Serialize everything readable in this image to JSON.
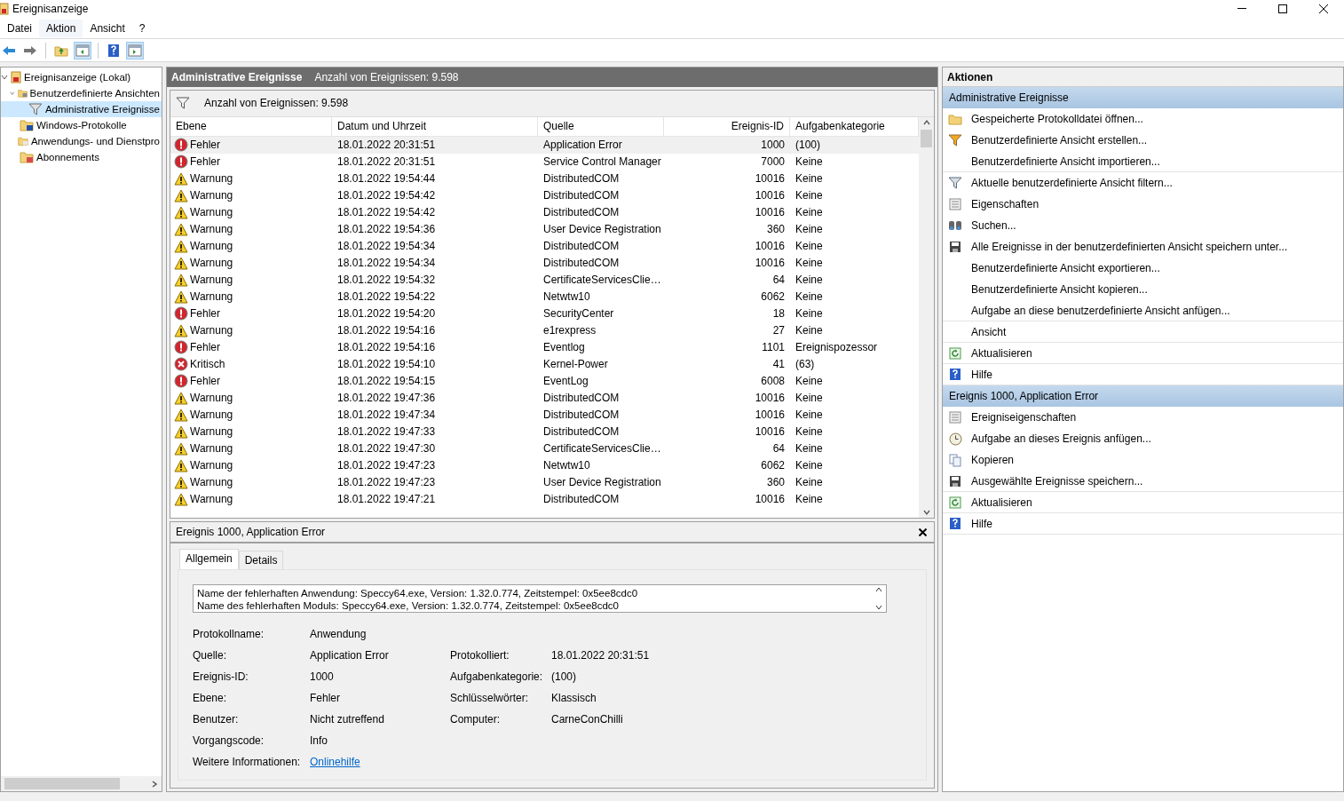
{
  "window": {
    "title": "Ereignisanzeige"
  },
  "menu": [
    {
      "label": "Datei",
      "selected": false
    },
    {
      "label": "Aktion",
      "selected": true
    },
    {
      "label": "Ansicht",
      "selected": false
    },
    {
      "label": "?",
      "selected": false
    }
  ],
  "tree": [
    {
      "label": "Ereignisanzeige (Lokal)",
      "kind": "viewer",
      "expanded": true,
      "selected": false,
      "children": [
        {
          "label": "Benutzerdefinierte Ansichten",
          "kind": "filterfolder",
          "expanded": true,
          "selected": false,
          "children": [
            {
              "label": "Administrative Ereignisse",
              "kind": "filter",
              "expanded": false,
              "selected": true
            }
          ]
        },
        {
          "label": "Windows-Protokolle",
          "kind": "logfolder",
          "expanded": false,
          "selected": false
        },
        {
          "label": "Anwendungs- und Dienstpro",
          "kind": "appfolder",
          "expanded": false,
          "selected": false
        },
        {
          "label": "Abonnements",
          "kind": "subfolder",
          "expanded": false,
          "selected": false
        }
      ]
    }
  ],
  "center": {
    "title": "Administrative Ereignisse",
    "count": "Anzahl von Ereignissen: 9.598",
    "filter_text": "Anzahl von Ereignissen: 9.598"
  },
  "table": {
    "columns": [
      "Ebene",
      "Datum und Uhrzeit",
      "Quelle",
      "Ereignis-ID",
      "Aufgabenkategorie"
    ],
    "rows": [
      {
        "kind": "error",
        "level": "Fehler",
        "date": "18.01.2022 20:31:51",
        "source": "Application Error",
        "id": "1000",
        "category": "(100)",
        "selected": true
      },
      {
        "kind": "error",
        "level": "Fehler",
        "date": "18.01.2022 20:31:51",
        "source": "Service Control Manager",
        "id": "7000",
        "category": "Keine",
        "selected": false
      },
      {
        "kind": "warning",
        "level": "Warnung",
        "date": "18.01.2022 19:54:44",
        "source": "DistributedCOM",
        "id": "10016",
        "category": "Keine",
        "selected": false
      },
      {
        "kind": "warning",
        "level": "Warnung",
        "date": "18.01.2022 19:54:42",
        "source": "DistributedCOM",
        "id": "10016",
        "category": "Keine",
        "selected": false
      },
      {
        "kind": "warning",
        "level": "Warnung",
        "date": "18.01.2022 19:54:42",
        "source": "DistributedCOM",
        "id": "10016",
        "category": "Keine",
        "selected": false
      },
      {
        "kind": "warning",
        "level": "Warnung",
        "date": "18.01.2022 19:54:36",
        "source": "User Device Registration",
        "id": "360",
        "category": "Keine",
        "selected": false
      },
      {
        "kind": "warning",
        "level": "Warnung",
        "date": "18.01.2022 19:54:34",
        "source": "DistributedCOM",
        "id": "10016",
        "category": "Keine",
        "selected": false
      },
      {
        "kind": "warning",
        "level": "Warnung",
        "date": "18.01.2022 19:54:34",
        "source": "DistributedCOM",
        "id": "10016",
        "category": "Keine",
        "selected": false
      },
      {
        "kind": "warning",
        "level": "Warnung",
        "date": "18.01.2022 19:54:32",
        "source": "CertificateServicesClie…",
        "id": "64",
        "category": "Keine",
        "selected": false
      },
      {
        "kind": "warning",
        "level": "Warnung",
        "date": "18.01.2022 19:54:22",
        "source": "Netwtw10",
        "id": "6062",
        "category": "Keine",
        "selected": false
      },
      {
        "kind": "error",
        "level": "Fehler",
        "date": "18.01.2022 19:54:20",
        "source": "SecurityCenter",
        "id": "18",
        "category": "Keine",
        "selected": false
      },
      {
        "kind": "warning",
        "level": "Warnung",
        "date": "18.01.2022 19:54:16",
        "source": "e1rexpress",
        "id": "27",
        "category": "Keine",
        "selected": false
      },
      {
        "kind": "error",
        "level": "Fehler",
        "date": "18.01.2022 19:54:16",
        "source": "Eventlog",
        "id": "1101",
        "category": "Ereignispozessor",
        "selected": false
      },
      {
        "kind": "critical",
        "level": "Kritisch",
        "date": "18.01.2022 19:54:10",
        "source": "Kernel-Power",
        "id": "41",
        "category": "(63)",
        "selected": false
      },
      {
        "kind": "error",
        "level": "Fehler",
        "date": "18.01.2022 19:54:15",
        "source": "EventLog",
        "id": "6008",
        "category": "Keine",
        "selected": false
      },
      {
        "kind": "warning",
        "level": "Warnung",
        "date": "18.01.2022 19:47:36",
        "source": "DistributedCOM",
        "id": "10016",
        "category": "Keine",
        "selected": false
      },
      {
        "kind": "warning",
        "level": "Warnung",
        "date": "18.01.2022 19:47:34",
        "source": "DistributedCOM",
        "id": "10016",
        "category": "Keine",
        "selected": false
      },
      {
        "kind": "warning",
        "level": "Warnung",
        "date": "18.01.2022 19:47:33",
        "source": "DistributedCOM",
        "id": "10016",
        "category": "Keine",
        "selected": false
      },
      {
        "kind": "warning",
        "level": "Warnung",
        "date": "18.01.2022 19:47:30",
        "source": "CertificateServicesClie…",
        "id": "64",
        "category": "Keine",
        "selected": false
      },
      {
        "kind": "warning",
        "level": "Warnung",
        "date": "18.01.2022 19:47:23",
        "source": "Netwtw10",
        "id": "6062",
        "category": "Keine",
        "selected": false
      },
      {
        "kind": "warning",
        "level": "Warnung",
        "date": "18.01.2022 19:47:23",
        "source": "User Device Registration",
        "id": "360",
        "category": "Keine",
        "selected": false
      },
      {
        "kind": "warning",
        "level": "Warnung",
        "date": "18.01.2022 19:47:21",
        "source": "DistributedCOM",
        "id": "10016",
        "category": "Keine",
        "selected": false
      }
    ]
  },
  "detail": {
    "title": "Ereignis 1000, Application Error",
    "tabs": [
      {
        "label": "Allgemein",
        "selected": true
      },
      {
        "label": "Details",
        "selected": false
      }
    ],
    "description": [
      "Name der fehlerhaften Anwendung: Speccy64.exe, Version: 1.32.0.774, Zeitstempel: 0x5ee8cdc0",
      "Name des fehlerhaften Moduls: Speccy64.exe, Version: 1.32.0.774, Zeitstempel: 0x5ee8cdc0"
    ],
    "fields_left": [
      {
        "label": "Protokollname:",
        "value": "Anwendung"
      },
      {
        "label": "Quelle:",
        "value": "Application Error"
      },
      {
        "label": "Ereignis-ID:",
        "value": "1000"
      },
      {
        "label": "Ebene:",
        "value": "Fehler"
      },
      {
        "label": "Benutzer:",
        "value": "Nicht zutreffend"
      },
      {
        "label": "Vorgangscode:",
        "value": "Info"
      },
      {
        "label": "Weitere Informationen:",
        "value": "Onlinehilfe",
        "kind": "link"
      }
    ],
    "fields_right": [
      {
        "label": "Protokolliert:",
        "value": "18.01.2022 20:31:51"
      },
      {
        "label": "Aufgabenkategorie:",
        "value": "(100)"
      },
      {
        "label": "Schlüsselwörter:",
        "value": "Klassisch"
      },
      {
        "label": "Computer:",
        "value": "CarneConChilli"
      }
    ]
  },
  "actions": {
    "title": "Aktionen",
    "sections": [
      {
        "title": "Administrative Ereignisse",
        "items": [
          {
            "label": "Gespeicherte Protokolldatei öffnen...",
            "kind": "folder",
            "separator": false
          },
          {
            "label": "Benutzerdefinierte Ansicht erstellen...",
            "kind": "create",
            "separator": false
          },
          {
            "label": "Benutzerdefinierte Ansicht importieren...",
            "kind": "plain",
            "separator": true
          },
          {
            "label": "Aktuelle benutzerdefinierte Ansicht filtern...",
            "kind": "filter",
            "separator": false
          },
          {
            "label": "Eigenschaften",
            "kind": "properties",
            "separator": false
          },
          {
            "label": "Suchen...",
            "kind": "find",
            "separator": false
          },
          {
            "label": "Alle Ereignisse in der benutzerdefinierten Ansicht speichern unter...",
            "kind": "save",
            "separator": false
          },
          {
            "label": "Benutzerdefinierte Ansicht exportieren...",
            "kind": "plain",
            "separator": false
          },
          {
            "label": "Benutzerdefinierte Ansicht kopieren...",
            "kind": "plain",
            "separator": false
          },
          {
            "label": "Aufgabe an diese benutzerdefinierte Ansicht anfügen...",
            "kind": "plain",
            "separator": true
          },
          {
            "label": "Ansicht",
            "kind": "plain",
            "separator": true
          },
          {
            "label": "Aktualisieren",
            "kind": "refresh",
            "separator": true
          },
          {
            "label": "Hilfe",
            "kind": "help",
            "separator": true
          }
        ]
      },
      {
        "title": "Ereignis 1000, Application Error",
        "items": [
          {
            "label": "Ereigniseigenschaften",
            "kind": "properties",
            "separator": false
          },
          {
            "label": "Aufgabe an dieses Ereignis anfügen...",
            "kind": "task",
            "separator": false
          },
          {
            "label": "Kopieren",
            "kind": "copy",
            "separator": false
          },
          {
            "label": "Ausgewählte Ereignisse speichern...",
            "kind": "save",
            "separator": true
          },
          {
            "label": "Aktualisieren",
            "kind": "refresh",
            "separator": true
          },
          {
            "label": "Hilfe",
            "kind": "help",
            "separator": true
          }
        ]
      }
    ]
  }
}
